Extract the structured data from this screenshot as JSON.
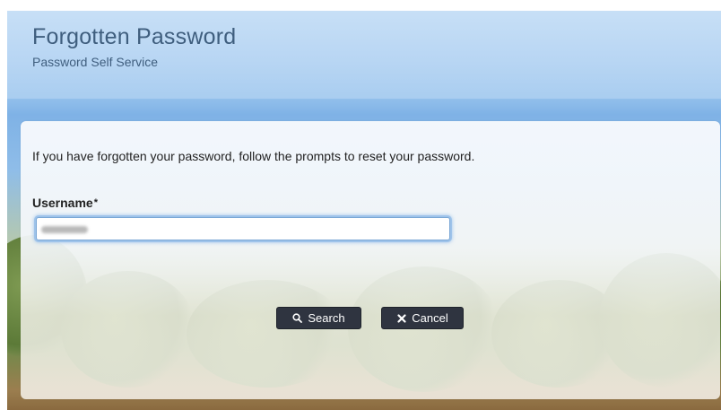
{
  "header": {
    "title": "Forgotten Password",
    "subtitle": "Password Self Service"
  },
  "form": {
    "intro_text": "If you have forgotten your password, follow the prompts to reset your password.",
    "username_label": "Username",
    "required_marker": "*",
    "username_value": "",
    "username_obscured": true
  },
  "buttons": {
    "search_label": "Search",
    "search_icon": "search-icon",
    "cancel_label": "Cancel",
    "cancel_icon": "close-icon"
  },
  "colors": {
    "title_text": "#3f5e7e",
    "button_bg": "#2f3440",
    "focus_ring": "#9ec3ea"
  }
}
